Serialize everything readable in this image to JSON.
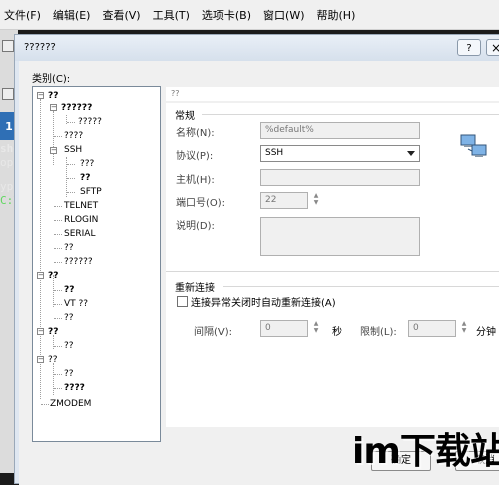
{
  "menubar": {
    "items": [
      "文件(F)",
      "编辑(E)",
      "查看(V)",
      "工具(T)",
      "选项卡(B)",
      "窗口(W)",
      "帮助(H)"
    ]
  },
  "background": {
    "tab_number": "1",
    "terminal_lines": [
      "she",
      "opy",
      "ype",
      "C:\\"
    ]
  },
  "dialog": {
    "title": "??????",
    "help": "?",
    "close": "×",
    "category_label": "类别(C):",
    "tree": [
      {
        "label": "??",
        "bold": true
      },
      {
        "label": "??????",
        "bold": true
      },
      {
        "label": "?????",
        "bold": false
      },
      {
        "label": "????",
        "bold": false
      },
      {
        "label": "SSH",
        "bold": false
      },
      {
        "label": "???",
        "bold": false
      },
      {
        "label": "??",
        "bold": true
      },
      {
        "label": "SFTP",
        "bold": false
      },
      {
        "label": "TELNET",
        "bold": false
      },
      {
        "label": "RLOGIN",
        "bold": false
      },
      {
        "label": "SERIAL",
        "bold": false
      },
      {
        "label": "??",
        "bold": false
      },
      {
        "label": "??????",
        "bold": false
      },
      {
        "label": "??",
        "bold": true
      },
      {
        "label": "??",
        "bold": true
      },
      {
        "label": "VT ??",
        "bold": false
      },
      {
        "label": "??",
        "bold": false
      },
      {
        "label": "??",
        "bold": true
      },
      {
        "label": "??",
        "bold": false
      },
      {
        "label": "??",
        "bold": false
      },
      {
        "label": "??",
        "bold": false
      },
      {
        "label": "????",
        "bold": true
      },
      {
        "label": "ZMODEM",
        "bold": false
      }
    ],
    "path": "??",
    "general": {
      "title": "常规",
      "name_label": "名称(N):",
      "name_value": "%default%",
      "protocol_label": "协议(P):",
      "protocol_value": "SSH",
      "host_label": "主机(H):",
      "host_value": "",
      "port_label": "端口号(O):",
      "port_value": "22",
      "desc_label": "说明(D):",
      "desc_value": ""
    },
    "reconnect": {
      "title": "重新连接",
      "checkbox_label": "连接异常关闭时自动重新连接(A)",
      "checked": false,
      "interval_label": "间隔(V):",
      "interval_value": "0",
      "interval_unit": "秒",
      "limit_label": "限制(L):",
      "limit_value": "0",
      "limit_unit": "分钟"
    },
    "buttons": {
      "ok": "确定",
      "cancel": "取消"
    }
  },
  "watermark": "im下载站"
}
